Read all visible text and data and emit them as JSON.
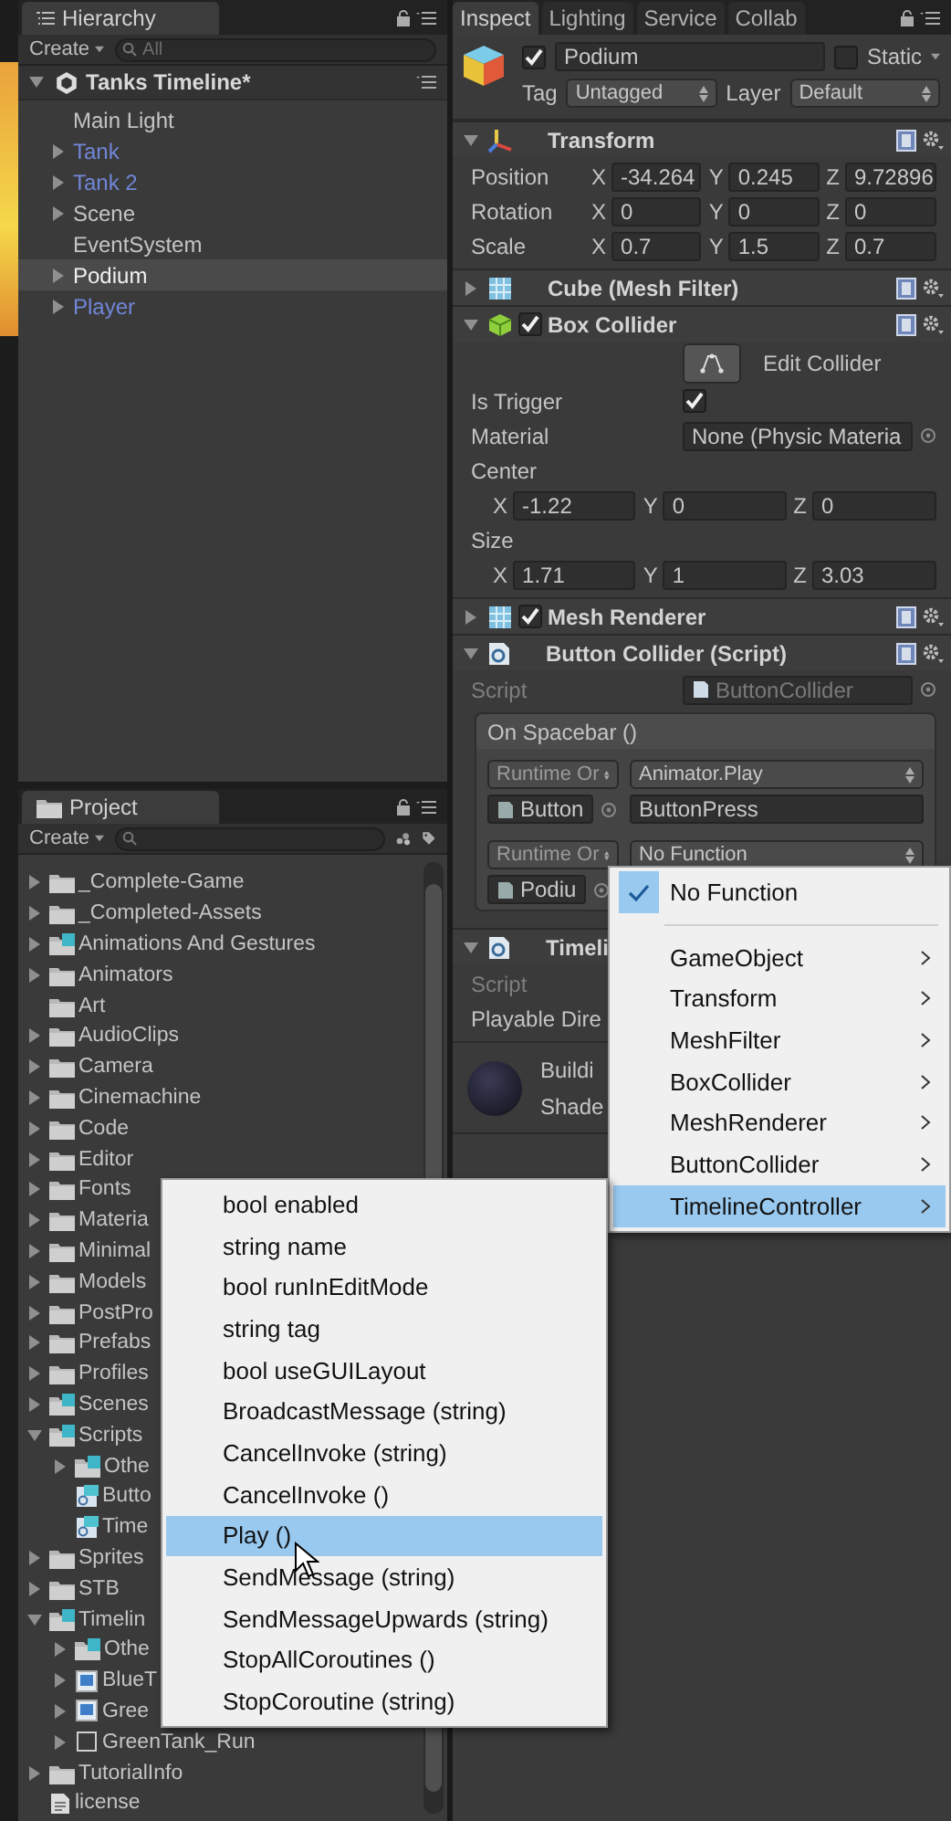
{
  "hierarchy": {
    "tab": "Hierarchy",
    "create": "Create",
    "search_placeholder": "All",
    "scene": {
      "name": "Tanks Timeline*",
      "expanded": true
    },
    "items": [
      {
        "name": "Main Light",
        "kind": "object",
        "selected": false
      },
      {
        "name": "Tank",
        "kind": "prefab",
        "expanded": false,
        "selected": false
      },
      {
        "name": "Tank 2",
        "kind": "prefab",
        "expanded": false,
        "selected": false
      },
      {
        "name": "Scene",
        "kind": "object",
        "expanded": false,
        "selected": false
      },
      {
        "name": "EventSystem",
        "kind": "object",
        "selected": false
      },
      {
        "name": "Podium",
        "kind": "object",
        "expanded": false,
        "selected": true
      },
      {
        "name": "Player",
        "kind": "prefab",
        "expanded": false,
        "selected": false
      }
    ]
  },
  "project": {
    "tab": "Project",
    "create": "Create",
    "items": [
      {
        "name": "_Complete-Game",
        "kind": "folder",
        "expanded": false
      },
      {
        "name": "_Completed-Assets",
        "kind": "folder",
        "expanded": false
      },
      {
        "name": "Animations And Gestures",
        "kind": "asset_folder",
        "expanded": false
      },
      {
        "name": "Animators",
        "kind": "folder",
        "expanded": false
      },
      {
        "name": "Art",
        "kind": "folder"
      },
      {
        "name": "AudioClips",
        "kind": "folder",
        "expanded": false
      },
      {
        "name": "Camera",
        "kind": "folder",
        "expanded": false
      },
      {
        "name": "Cinemachine",
        "kind": "folder",
        "expanded": false
      },
      {
        "name": "Code",
        "kind": "folder",
        "expanded": false
      },
      {
        "name": "Editor",
        "kind": "folder",
        "expanded": false
      },
      {
        "name": "Fonts",
        "kind": "folder",
        "expanded": false
      },
      {
        "name": "Materia",
        "kind": "folder",
        "expanded": false
      },
      {
        "name": "Minimal",
        "kind": "folder",
        "expanded": false
      },
      {
        "name": "Models",
        "kind": "folder",
        "expanded": false
      },
      {
        "name": "PostPro",
        "kind": "folder",
        "expanded": false
      },
      {
        "name": "Prefabs",
        "kind": "folder",
        "expanded": false
      },
      {
        "name": "Profiles",
        "kind": "folder",
        "expanded": false
      },
      {
        "name": "Scenes",
        "kind": "asset_folder",
        "expanded": false
      },
      {
        "name": "Scripts",
        "kind": "asset_folder",
        "expanded": true,
        "children": [
          {
            "name": "Othe",
            "kind": "asset_folder",
            "expanded": false
          },
          {
            "name": "Butto",
            "kind": "script"
          },
          {
            "name": "Time",
            "kind": "script"
          }
        ]
      },
      {
        "name": "Sprites",
        "kind": "folder",
        "expanded": false
      },
      {
        "name": "STB",
        "kind": "folder",
        "expanded": false
      },
      {
        "name": "Timelin",
        "kind": "asset_folder",
        "expanded": true,
        "children": [
          {
            "name": "Othe",
            "kind": "asset_folder",
            "expanded": false
          },
          {
            "name": "BlueT",
            "kind": "timeline",
            "expanded": false
          },
          {
            "name": "Gree",
            "kind": "timeline",
            "expanded": false
          },
          {
            "name": "GreenTank_Run",
            "kind": "blank",
            "expanded": false
          }
        ]
      },
      {
        "name": "TutorialInfo",
        "kind": "folder",
        "expanded": false
      },
      {
        "name": "license",
        "kind": "text_file"
      }
    ]
  },
  "inspector": {
    "tabs": [
      {
        "label": "Inspect",
        "selected": true
      },
      {
        "label": "Lighting",
        "selected": false
      },
      {
        "label": "Service",
        "selected": false
      },
      {
        "label": "Collab",
        "selected": false
      }
    ],
    "object": {
      "active": true,
      "name": "Podium",
      "static": false,
      "static_label": "Static",
      "tag_label": "Tag",
      "tag": "Untagged",
      "layer_label": "Layer",
      "layer": "Default"
    },
    "components": [
      {
        "title": "Transform",
        "kind": "transform",
        "expanded": true,
        "rows": [
          {
            "kind": "vector",
            "label": "Position",
            "values": [
              {
                "axis": "X",
                "value": "-34.264"
              },
              {
                "axis": "Y",
                "value": "0.245"
              },
              {
                "axis": "Z",
                "value": "9.72896"
              }
            ]
          },
          {
            "kind": "vector",
            "label": "Rotation",
            "values": [
              {
                "axis": "X",
                "value": "0"
              },
              {
                "axis": "Y",
                "value": "0"
              },
              {
                "axis": "Z",
                "value": "0"
              }
            ]
          },
          {
            "kind": "vector",
            "label": "Scale",
            "values": [
              {
                "axis": "X",
                "value": "0.7"
              },
              {
                "axis": "Y",
                "value": "1.5"
              },
              {
                "axis": "Z",
                "value": "0.7"
              }
            ]
          }
        ]
      },
      {
        "title": "Cube (Mesh Filter)",
        "kind": "mesh",
        "expanded": false
      },
      {
        "title": "Box Collider",
        "kind": "collider",
        "expanded": true,
        "enabled": true,
        "rows": [
          {
            "kind": "button",
            "label": "Edit Collider"
          },
          {
            "kind": "check",
            "label": "Is Trigger",
            "checked": true
          },
          {
            "kind": "object",
            "label": "Material",
            "value": "None (Physic Materia"
          },
          {
            "kind": "heading",
            "label": "Center"
          },
          {
            "kind": "vector",
            "values": [
              {
                "axis": "X",
                "value": "-1.22"
              },
              {
                "axis": "Y",
                "value": "0"
              },
              {
                "axis": "Z",
                "value": "0"
              }
            ]
          },
          {
            "kind": "heading",
            "label": "Size"
          },
          {
            "kind": "vector",
            "values": [
              {
                "axis": "X",
                "value": "1.71"
              },
              {
                "axis": "Y",
                "value": "1"
              },
              {
                "axis": "Z",
                "value": "3.03"
              }
            ]
          }
        ]
      },
      {
        "title": "Mesh Renderer",
        "kind": "mesh",
        "expanded": false,
        "enabled": true
      },
      {
        "title": "Button Collider (Script)",
        "kind": "script",
        "expanded": true,
        "rows": [
          {
            "kind": "script",
            "label": "Script",
            "value": "ButtonCollider"
          },
          {
            "kind": "event",
            "title": "On Spacebar ()",
            "listeners": [
              {
                "mode": "Runtime Or",
                "function": "Animator.Play",
                "target": "Button",
                "argument": "ButtonPress"
              },
              {
                "mode": "Runtime Or",
                "function": "No Function",
                "target": "Podiu"
              }
            ]
          }
        ]
      },
      {
        "title": "Timeli",
        "kind": "script",
        "expanded": true,
        "rows": [
          {
            "kind": "script",
            "label": "Script"
          },
          {
            "kind": "heading",
            "label": "Playable Dire"
          }
        ]
      }
    ],
    "material": {
      "name": "Buildi",
      "shader": "Shade"
    }
  },
  "function_menu": {
    "items": [
      {
        "label": "No Function",
        "kind": "check",
        "checked": true,
        "selected": false
      },
      {
        "kind": "separator"
      },
      {
        "label": "GameObject",
        "kind": "submenu",
        "selected": false
      },
      {
        "label": "Transform",
        "kind": "submenu",
        "selected": false
      },
      {
        "label": "MeshFilter",
        "kind": "submenu",
        "selected": false
      },
      {
        "label": "BoxCollider",
        "kind": "submenu",
        "selected": false
      },
      {
        "label": "MeshRenderer",
        "kind": "submenu",
        "selected": false
      },
      {
        "label": "ButtonCollider",
        "kind": "submenu",
        "selected": false
      },
      {
        "label": "TimelineController",
        "kind": "submenu",
        "selected": true
      }
    ]
  },
  "method_menu": {
    "items": [
      {
        "label": "bool enabled",
        "selected": false
      },
      {
        "label": "string name",
        "selected": false
      },
      {
        "label": "bool runInEditMode",
        "selected": false
      },
      {
        "label": "string tag",
        "selected": false
      },
      {
        "label": "bool useGUILayout",
        "selected": false
      },
      {
        "label": "BroadcastMessage (string)",
        "selected": false
      },
      {
        "label": "CancelInvoke (string)",
        "selected": false
      },
      {
        "label": "CancelInvoke ()",
        "selected": false
      },
      {
        "label": "Play ()",
        "selected": true
      },
      {
        "label": "SendMessage (string)",
        "selected": false
      },
      {
        "label": "SendMessageUpwards (string)",
        "selected": false
      },
      {
        "label": "StopAllCoroutines ()",
        "selected": false
      },
      {
        "label": "StopCoroutine (string)",
        "selected": false
      }
    ]
  }
}
